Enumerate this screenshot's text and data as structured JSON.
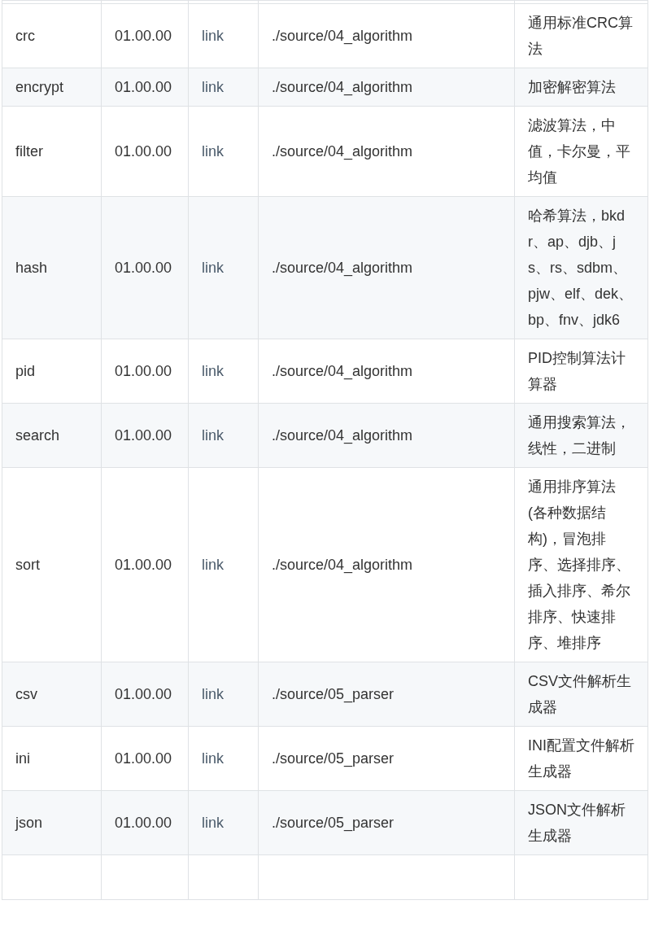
{
  "table": {
    "rows": [
      {
        "name": "crc",
        "version": "01.00.00",
        "link": "link",
        "path": "./source/04_algorithm",
        "description": "通用标准CRC算法"
      },
      {
        "name": "encrypt",
        "version": "01.00.00",
        "link": "link",
        "path": "./source/04_algorithm",
        "description": "加密解密算法"
      },
      {
        "name": "filter",
        "version": "01.00.00",
        "link": "link",
        "path": "./source/04_algorithm",
        "description": "滤波算法，中值，卡尔曼，平均值"
      },
      {
        "name": "hash",
        "version": "01.00.00",
        "link": "link",
        "path": "./source/04_algorithm",
        "description": "哈希算法，bkdr、ap、djb、js、rs、sdbm、pjw、elf、dek、bp、fnv、jdk6"
      },
      {
        "name": "pid",
        "version": "01.00.00",
        "link": "link",
        "path": "./source/04_algorithm",
        "description": "PID控制算法计算器"
      },
      {
        "name": "search",
        "version": "01.00.00",
        "link": "link",
        "path": "./source/04_algorithm",
        "description": "通用搜索算法，线性，二进制"
      },
      {
        "name": "sort",
        "version": "01.00.00",
        "link": "link",
        "path": "./source/04_algorithm",
        "description": "通用排序算法(各种数据结构)，冒泡排序、选择排序、插入排序、希尔排序、快速排序、堆排序"
      },
      {
        "name": "csv",
        "version": "01.00.00",
        "link": "link",
        "path": "./source/05_parser",
        "description": "CSV文件解析生成器"
      },
      {
        "name": "ini",
        "version": "01.00.00",
        "link": "link",
        "path": "./source/05_parser",
        "description": "INI配置文件解析生成器"
      },
      {
        "name": "json",
        "version": "01.00.00",
        "link": "link",
        "path": "./source/05_parser",
        "description": "JSON文件解析生成器"
      }
    ]
  }
}
